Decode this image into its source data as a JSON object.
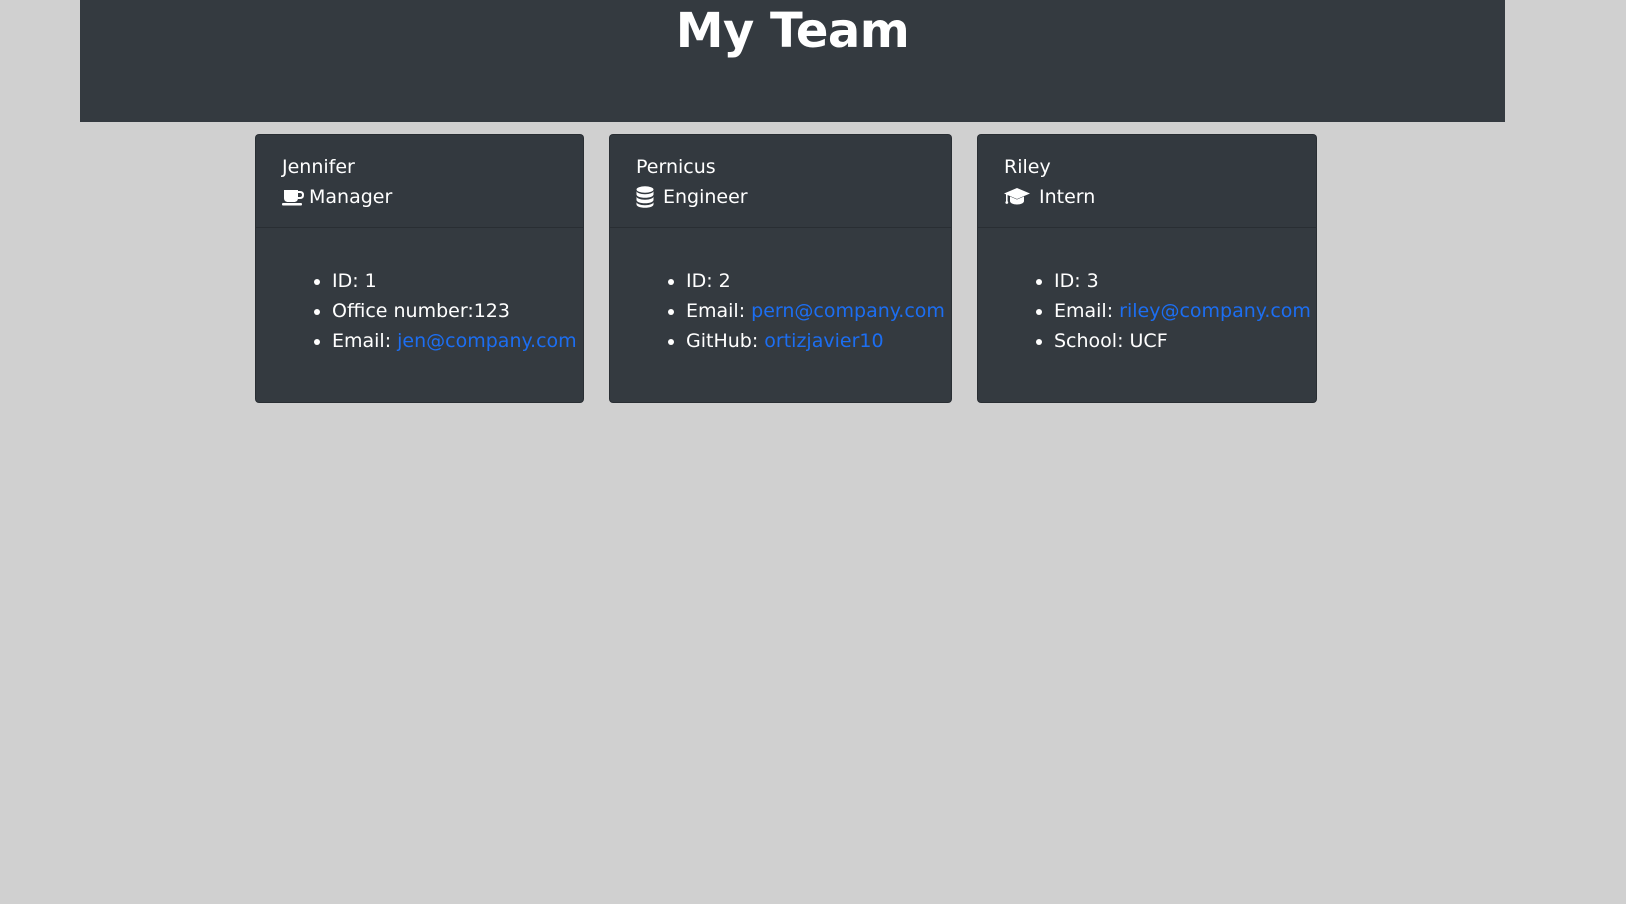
{
  "header": {
    "title": "My Team"
  },
  "colors": {
    "page_bg": "#d0d0d0",
    "card_bg": "#343a40",
    "text": "#ffffff",
    "link": "#1c6ef2"
  },
  "cards": [
    {
      "name": "Jennifer",
      "role": "Manager",
      "role_icon": "coffee-mug-icon",
      "items": [
        {
          "label": "ID: 1"
        },
        {
          "label": "Office number:123"
        },
        {
          "label": "Email: ",
          "link": "jen@company.com"
        }
      ]
    },
    {
      "name": "Pernicus",
      "role": "Engineer",
      "role_icon": "database-icon",
      "items": [
        {
          "label": "ID: 2"
        },
        {
          "label": "Email: ",
          "link": "pern@company.com"
        },
        {
          "label": "GitHub: ",
          "link": "ortizjavier10"
        }
      ]
    },
    {
      "name": "Riley",
      "role": "Intern",
      "role_icon": "graduation-cap-icon",
      "items": [
        {
          "label": "ID: 3"
        },
        {
          "label": "Email: ",
          "link": "riley@company.com"
        },
        {
          "label": "School: UCF"
        }
      ]
    }
  ]
}
